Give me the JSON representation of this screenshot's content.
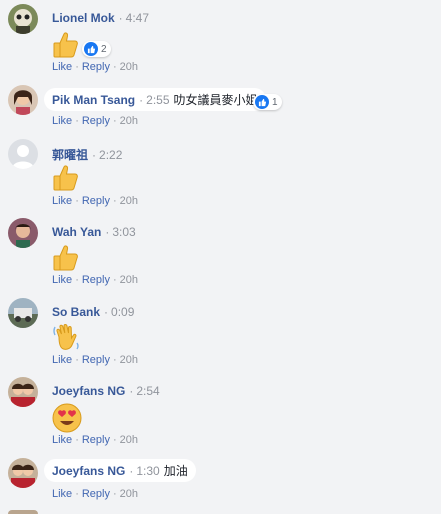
{
  "actions": {
    "like": "Like",
    "reply": "Reply",
    "age": "20h"
  },
  "comments": [
    {
      "author": "Lionel Mok",
      "time": "4:47",
      "text": "",
      "emoji": "thumbs-up",
      "reactions": "2"
    },
    {
      "author": "Pik Man Tsang",
      "time": "2:55",
      "text": "叻女議員麥小姐",
      "emoji": "",
      "reactions": "1"
    },
    {
      "author": "郭曜祖",
      "time": "2:22",
      "text": "",
      "emoji": "thumbs-up",
      "reactions": ""
    },
    {
      "author": "Wah Yan",
      "time": "3:03",
      "text": "",
      "emoji": "thumbs-up",
      "reactions": ""
    },
    {
      "author": "So Bank",
      "time": "0:09",
      "text": "",
      "emoji": "waving-hand",
      "reactions": ""
    },
    {
      "author": "Joeyfans NG",
      "time": "2:54",
      "text": "",
      "emoji": "heart-eyes",
      "reactions": ""
    },
    {
      "author": "Joeyfans NG",
      "time": "1:30",
      "text": "加油",
      "emoji": "",
      "reactions": ""
    }
  ],
  "colors": {
    "author": "#385898",
    "link": "#4267b2",
    "meta": "#90949c",
    "like_badge": "#1877f2",
    "background": "#f2f3f5"
  }
}
